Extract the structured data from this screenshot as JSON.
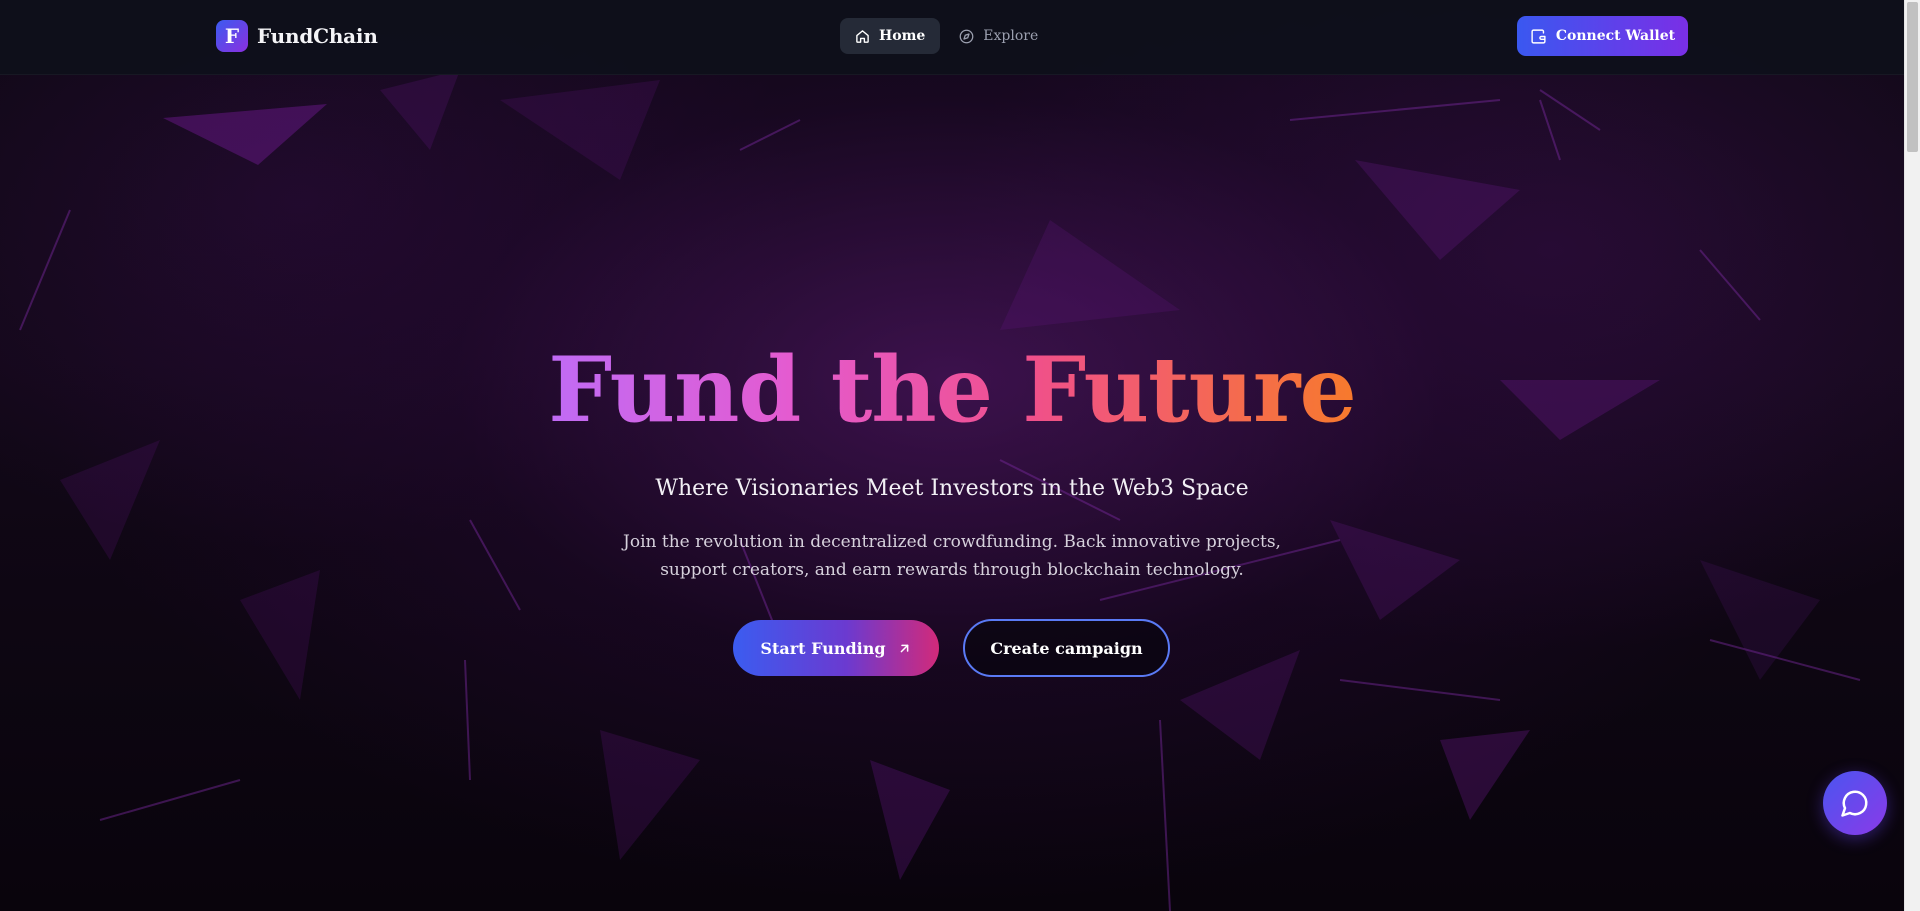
{
  "header": {
    "brand_letter": "F",
    "brand_name": "FundChain",
    "nav": [
      {
        "label": "Home",
        "icon": "home-icon",
        "active": true
      },
      {
        "label": "Explore",
        "icon": "compass-icon",
        "active": false
      }
    ],
    "connect_wallet_label": "Connect Wallet"
  },
  "hero": {
    "title": "Fund the Future",
    "subtitle": "Where Visionaries Meet Investors in the Web3 Space",
    "description_line1": "Join the revolution in decentralized crowdfunding. Back innovative projects,",
    "description_line2": "support creators, and earn rewards through blockchain technology.",
    "primary_cta": "Start Funding",
    "secondary_cta": "Create campaign"
  },
  "colors": {
    "accent_blue": "#3b5cf0",
    "accent_purple": "#7a2fe6",
    "gradient_pink": "#e45bd0",
    "gradient_orange": "#f77a2c"
  },
  "chat": {
    "icon": "chat-bubble-icon"
  }
}
